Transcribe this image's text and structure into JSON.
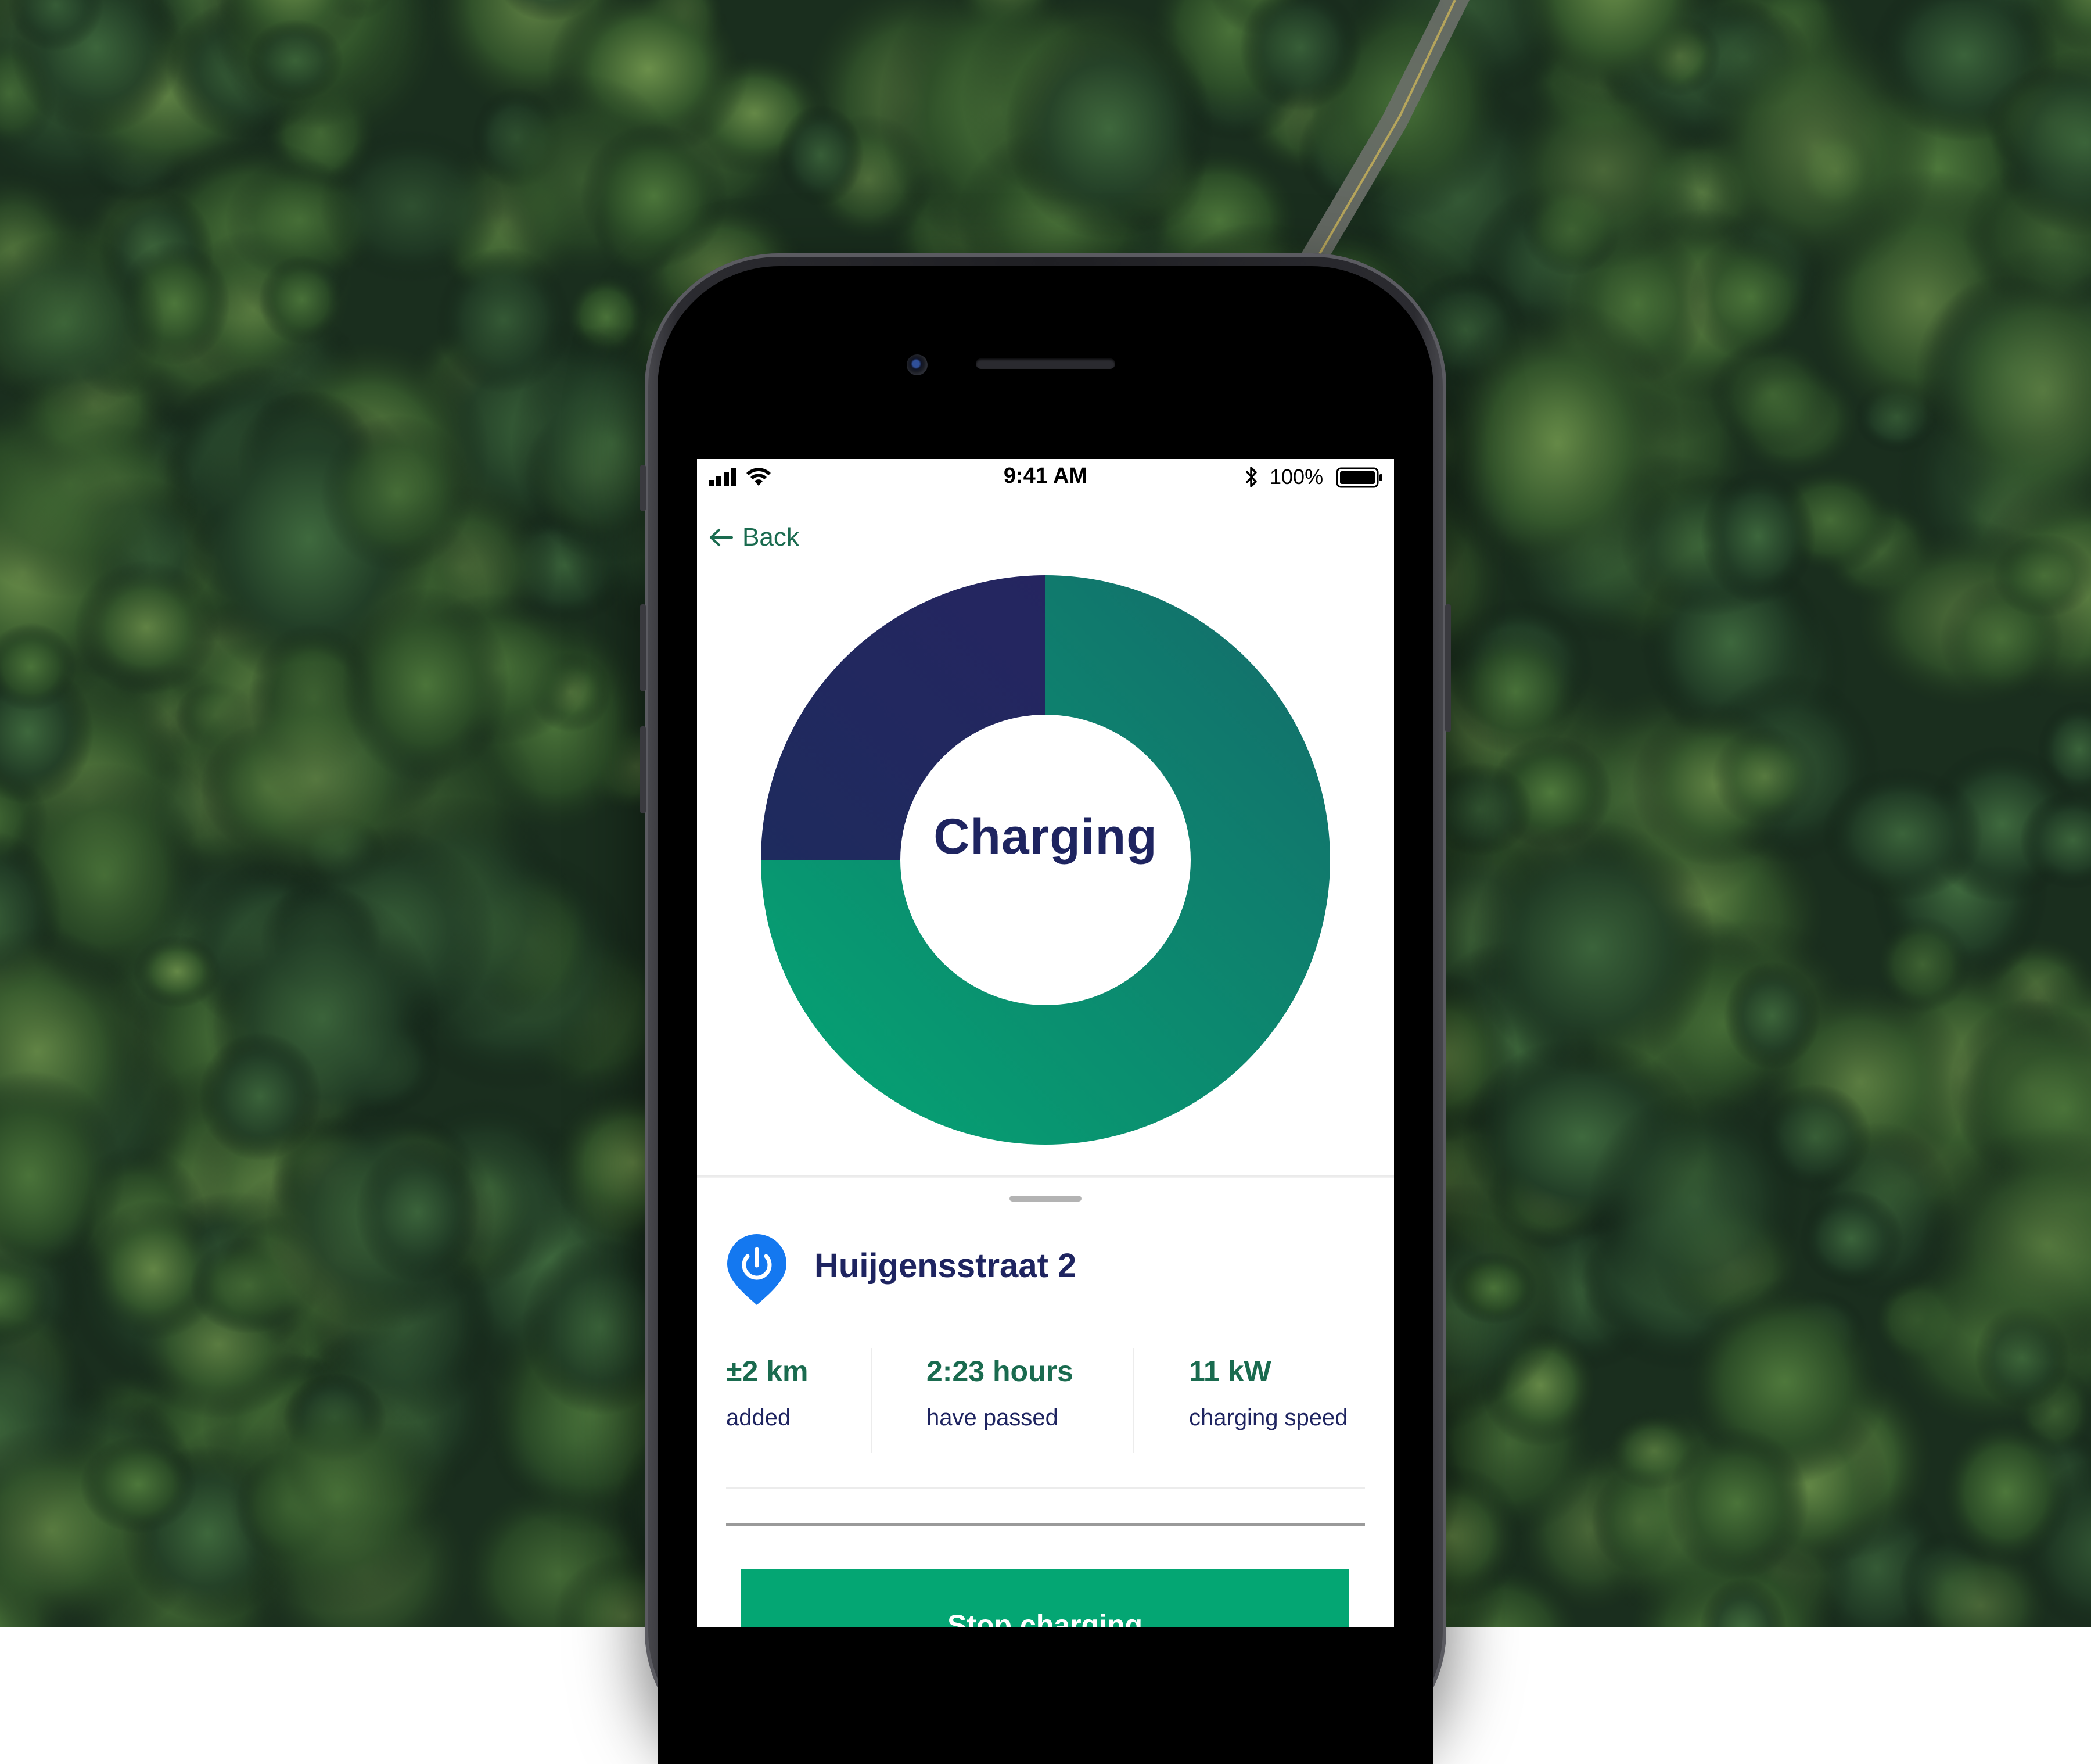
{
  "status_bar": {
    "time": "9:41 AM",
    "battery_percent": "100%",
    "battery_level": 1.0
  },
  "navigation": {
    "back_label": "Back"
  },
  "charging_ring": {
    "status_label": "Charging",
    "progress_fraction": 0.75,
    "colors": {
      "progress_start": "#04a673",
      "progress_end": "#146b6b",
      "remaining_start": "#1e2b5e",
      "remaining_end": "#252560"
    }
  },
  "station": {
    "name": "Huijgensstraat 2",
    "icon": "power-pin-icon",
    "pin_color": "#1478f0"
  },
  "stats": [
    {
      "value": "±2 km",
      "label": "added"
    },
    {
      "value": "2:23 hours",
      "label": "have passed"
    },
    {
      "value": "11 kW",
      "label": "charging speed"
    }
  ],
  "actions": {
    "stop_label": "Stop charging",
    "stop_color": "#04a673"
  },
  "colors": {
    "accent_green": "#1a6b4f",
    "navy_text": "#1e2460"
  }
}
